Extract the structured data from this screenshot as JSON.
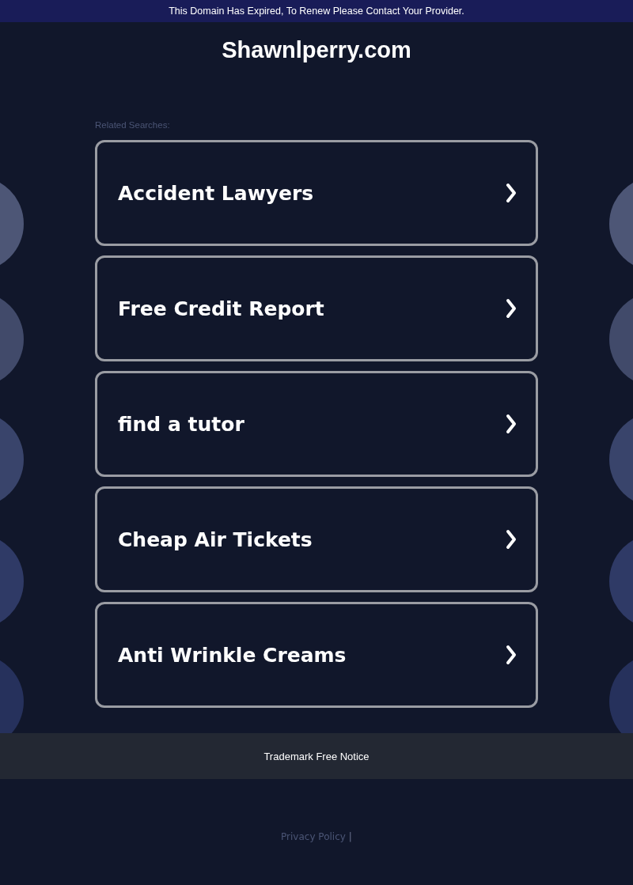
{
  "banner": {
    "text": "This Domain Has Expired, To Renew Please Contact Your Provider."
  },
  "site_title": "Shawnlperry.com",
  "related_label": "Related Searches:",
  "searches": [
    {
      "label": "Accident Lawyers"
    },
    {
      "label": "Free Credit Report"
    },
    {
      "label": "find a tutor"
    },
    {
      "label": "Cheap Air Tickets"
    },
    {
      "label": "Anti Wrinkle Creams"
    }
  ],
  "trademark_notice": "Trademark Free Notice",
  "footer": {
    "privacy_link": "Privacy Policy",
    "separator": "|"
  }
}
